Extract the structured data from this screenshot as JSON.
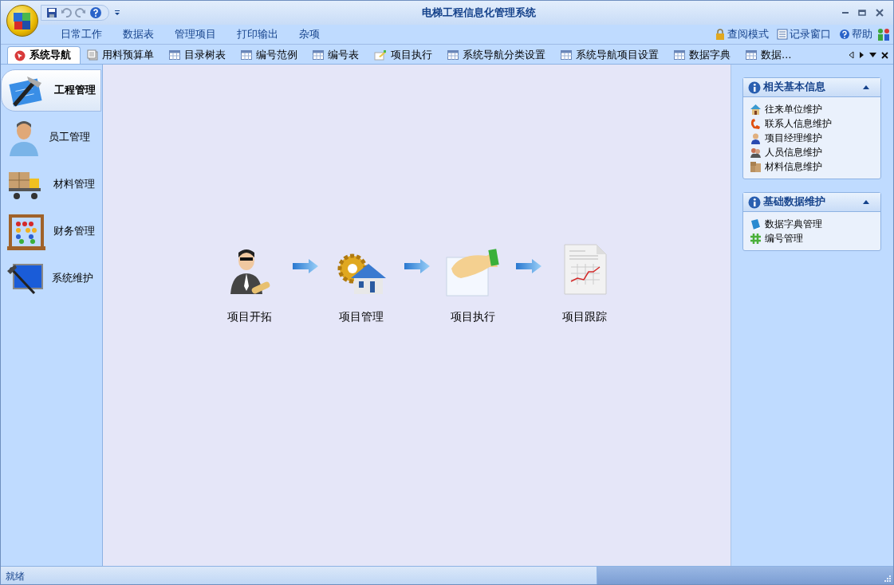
{
  "window": {
    "title": "电梯工程信息化管理系统"
  },
  "menu": [
    "日常工作",
    "数据表",
    "管理项目",
    "打印输出",
    "杂项"
  ],
  "toolbar_links": [
    {
      "kind": "lock",
      "label": "查阅模式"
    },
    {
      "kind": "log",
      "label": "记录窗口"
    },
    {
      "kind": "help",
      "label": "帮助"
    }
  ],
  "tabs": [
    {
      "kind": "nav",
      "label": "系统导航",
      "selected": true
    },
    {
      "kind": "doc",
      "label": "用料预算单",
      "selected": false
    },
    {
      "kind": "table",
      "label": "目录树表",
      "selected": false
    },
    {
      "kind": "table",
      "label": "编号范例",
      "selected": false
    },
    {
      "kind": "table",
      "label": "编号表",
      "selected": false
    },
    {
      "kind": "edit",
      "label": "项目执行",
      "selected": false
    },
    {
      "kind": "table",
      "label": "系统导航分类设置",
      "selected": false
    },
    {
      "kind": "table",
      "label": "系统导航项目设置",
      "selected": false
    },
    {
      "kind": "table",
      "label": "数据字典",
      "selected": false
    },
    {
      "kind": "table",
      "label": "数据…",
      "selected": false
    }
  ],
  "sidebar": {
    "items": [
      {
        "label": "工程管理",
        "selected": true
      },
      {
        "label": "员工管理",
        "selected": false
      },
      {
        "label": "材料管理",
        "selected": false
      },
      {
        "label": "财务管理",
        "selected": false
      },
      {
        "label": "系统维护",
        "selected": false
      }
    ]
  },
  "flow": {
    "steps": [
      {
        "label": "项目开拓"
      },
      {
        "label": "项目管理"
      },
      {
        "label": "项目执行"
      },
      {
        "label": "项目跟踪"
      }
    ]
  },
  "panels": [
    {
      "title": "相关基本信息",
      "expanded": true,
      "items": [
        {
          "label": "往来单位维护"
        },
        {
          "label": "联系人信息维护"
        },
        {
          "label": "项目经理维护"
        },
        {
          "label": "人员信息维护"
        },
        {
          "label": "材料信息维护"
        }
      ]
    },
    {
      "title": "基础数据维护",
      "expanded": true,
      "items": [
        {
          "label": "数据字典管理"
        },
        {
          "label": "编号管理"
        }
      ]
    }
  ],
  "status_bar": {
    "text": "就绪"
  }
}
